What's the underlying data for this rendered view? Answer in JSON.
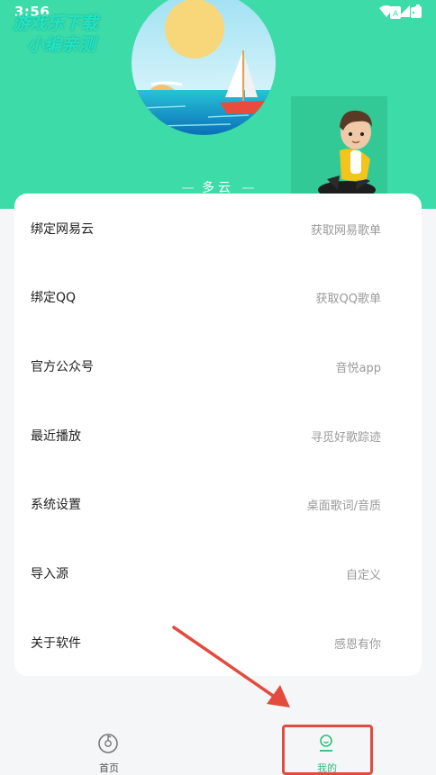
{
  "status_bar": {
    "time": "3:56",
    "icons": [
      "notification-a-icon",
      "notification-b-icon",
      "wifi-icon",
      "signal-icon",
      "battery-icon"
    ]
  },
  "watermark": {
    "line1": "游戏乐下载",
    "line2": "小编亲测"
  },
  "weather": {
    "text": "多云",
    "dash": "—"
  },
  "menu": [
    {
      "label": "绑定网易云",
      "desc": "获取网易歌单"
    },
    {
      "label": "绑定QQ",
      "desc": "获取QQ歌单"
    },
    {
      "label": "官方公众号",
      "desc": "音悦app"
    },
    {
      "label": "最近播放",
      "desc": "寻觅好歌踪迹"
    },
    {
      "label": "系统设置",
      "desc": "桌面歌词/音质"
    },
    {
      "label": "导入源",
      "desc": "自定义"
    },
    {
      "label": "关于软件",
      "desc": "感恩有你"
    }
  ],
  "bottom_nav": [
    {
      "label": "首页",
      "icon": "music-disc-icon"
    },
    {
      "label": "我的",
      "icon": "user-profile-icon",
      "active": true
    }
  ],
  "colors": {
    "header": "#3ddba7",
    "active_tab": "#2fbd7d",
    "annotation": "#e34b3c"
  }
}
